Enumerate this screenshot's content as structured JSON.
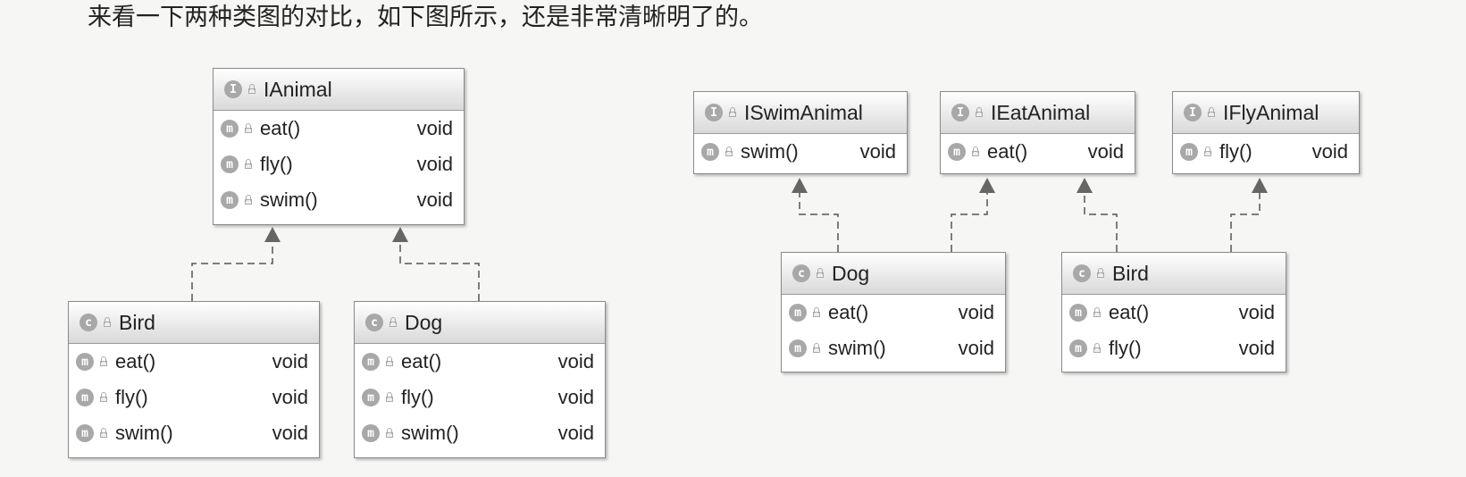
{
  "caption": "来看一下两种类图的对比，如下图所示，还是非常清晰明了的。",
  "left_diagram": {
    "interface": {
      "kind_badge": "I",
      "name": "IAnimal",
      "methods": [
        {
          "badge": "m",
          "name": "eat()",
          "type": "void"
        },
        {
          "badge": "m",
          "name": "fly()",
          "type": "void"
        },
        {
          "badge": "m",
          "name": "swim()",
          "type": "void"
        }
      ]
    },
    "classes": [
      {
        "kind_badge": "c",
        "name": "Bird",
        "methods": [
          {
            "badge": "m",
            "name": "eat()",
            "type": "void"
          },
          {
            "badge": "m",
            "name": "fly()",
            "type": "void"
          },
          {
            "badge": "m",
            "name": "swim()",
            "type": "void"
          }
        ]
      },
      {
        "kind_badge": "c",
        "name": "Dog",
        "methods": [
          {
            "badge": "m",
            "name": "eat()",
            "type": "void"
          },
          {
            "badge": "m",
            "name": "fly()",
            "type": "void"
          },
          {
            "badge": "m",
            "name": "swim()",
            "type": "void"
          }
        ]
      }
    ]
  },
  "right_diagram": {
    "interfaces": [
      {
        "kind_badge": "I",
        "name": "ISwimAnimal",
        "methods": [
          {
            "badge": "m",
            "name": "swim()",
            "type": "void"
          }
        ]
      },
      {
        "kind_badge": "I",
        "name": "IEatAnimal",
        "methods": [
          {
            "badge": "m",
            "name": "eat()",
            "type": "void"
          }
        ]
      },
      {
        "kind_badge": "I",
        "name": "IFlyAnimal",
        "methods": [
          {
            "badge": "m",
            "name": "fly()",
            "type": "void"
          }
        ]
      }
    ],
    "classes": [
      {
        "kind_badge": "c",
        "name": "Dog",
        "methods": [
          {
            "badge": "m",
            "name": "eat()",
            "type": "void"
          },
          {
            "badge": "m",
            "name": "swim()",
            "type": "void"
          }
        ]
      },
      {
        "kind_badge": "c",
        "name": "Bird",
        "methods": [
          {
            "badge": "m",
            "name": "eat()",
            "type": "void"
          },
          {
            "badge": "m",
            "name": "fly()",
            "type": "void"
          }
        ]
      }
    ]
  },
  "colors": {
    "background": "#f6f6f4",
    "border": "#8a8a8a",
    "badge": "#a8a8a8",
    "connector": "#555555",
    "text": "#222222"
  }
}
